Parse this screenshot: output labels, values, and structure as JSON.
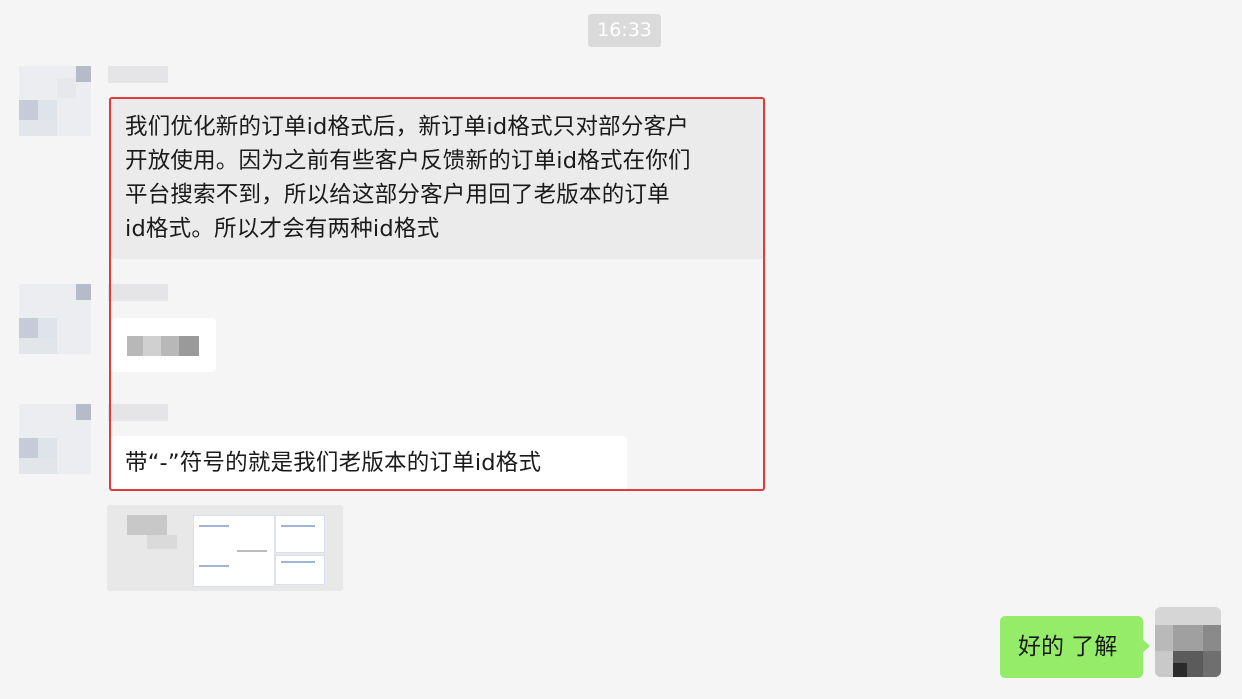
{
  "timestamp": "16:33",
  "messages": [
    {
      "text": "我们优化新的订单id格式后，新订单id格式只对部分客户开放使用。因为之前有些客户反馈新的订单id格式在你们平台搜索不到，所以给这部分客户用回了老版本的订单id格式。所以才会有两种id格式",
      "lines": [
        "我们优化新的订单id格式后，新订单id格式只对部分客户",
        "开放使用。因为之前有些客户反馈新的订单id格式在你们",
        "平台搜索不到，所以给这部分客户用回了老版本的订单",
        "id格式。所以才会有两种id格式"
      ]
    },
    {
      "text": "带“-”符号的就是我们老版本的订单id格式"
    }
  ],
  "reply": {
    "text": "好的 了解"
  },
  "colors": {
    "highlight_border": "#e03a3a",
    "reply_bubble": "#95ec69",
    "incoming_bubble": "#ffffff",
    "background": "#f5f5f5"
  }
}
